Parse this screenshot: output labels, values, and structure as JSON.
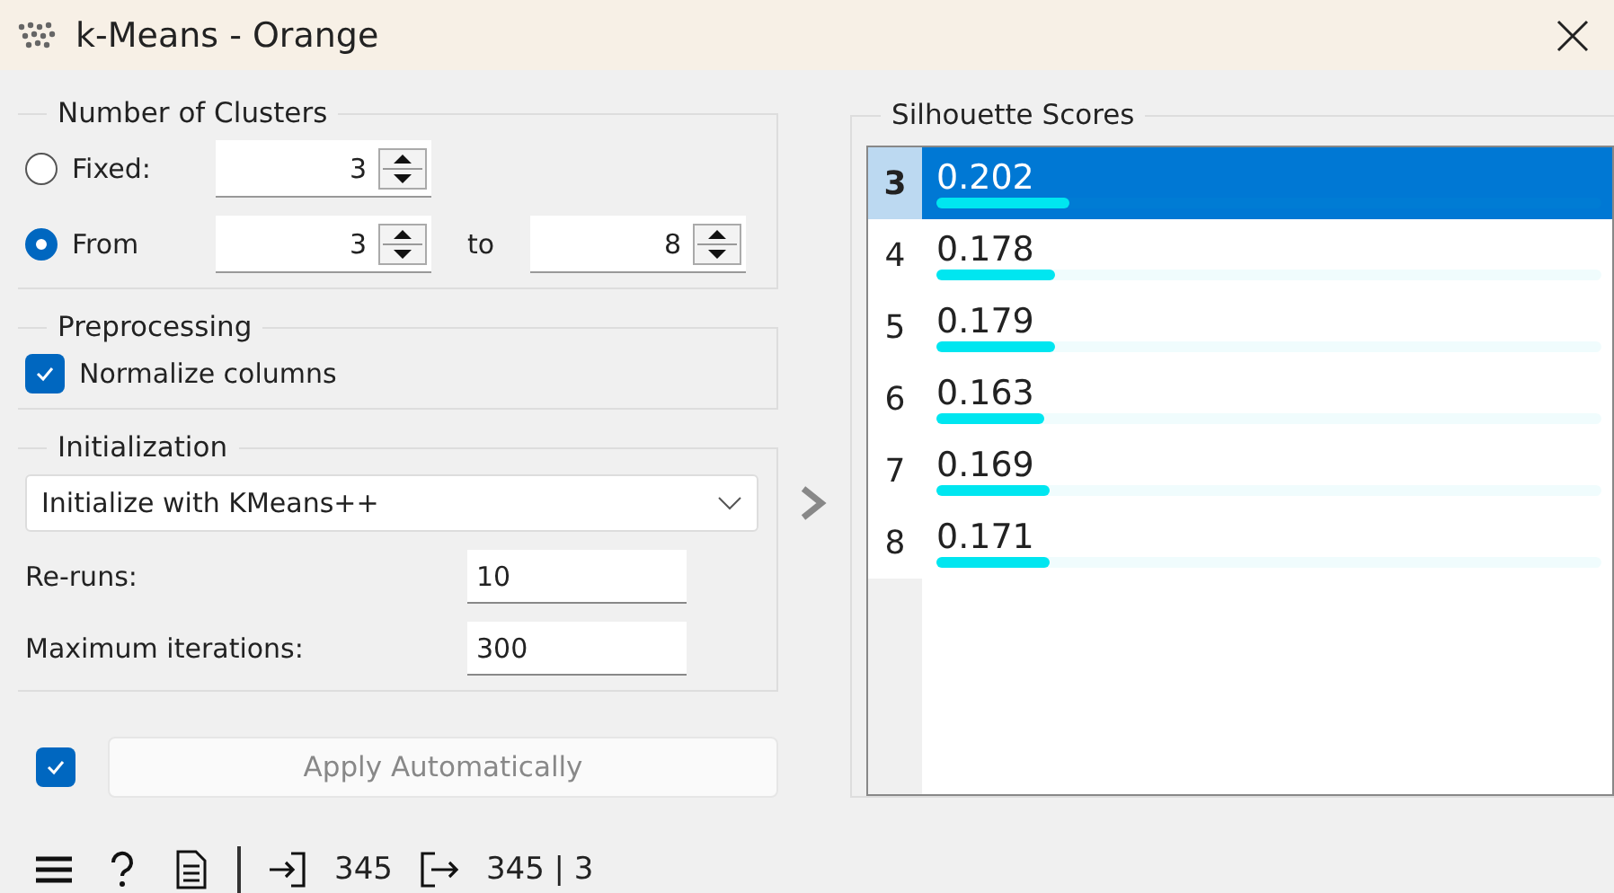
{
  "window": {
    "title": "k-Means - Orange"
  },
  "clusters": {
    "title": "Number of Clusters",
    "options": [
      {
        "label": "Fixed:",
        "selected": false,
        "values": [
          "3"
        ]
      },
      {
        "label": "From",
        "selected": true,
        "values": [
          "3",
          "8"
        ],
        "joiner": "to"
      }
    ]
  },
  "preprocessing": {
    "title": "Preprocessing",
    "checkbox": {
      "label": "Normalize columns",
      "checked": true
    }
  },
  "initialization": {
    "title": "Initialization",
    "method": "Initialize with KMeans++",
    "fields": [
      {
        "label": "Re-runs:",
        "value": "10"
      },
      {
        "label": "Maximum iterations:",
        "value": "300"
      }
    ]
  },
  "apply": {
    "checked": true,
    "label": "Apply Automatically"
  },
  "status_bar": {
    "input_count": "345",
    "output_count": "345 | 3"
  },
  "silhouette": {
    "title": "Silhouette Scores",
    "rows": [
      {
        "k": "3",
        "score": "0.202",
        "level": 0.2,
        "selected": true
      },
      {
        "k": "4",
        "score": "0.178",
        "level": 0.178,
        "selected": false
      },
      {
        "k": "5",
        "score": "0.179",
        "level": 0.179,
        "selected": false
      },
      {
        "k": "6",
        "score": "0.163",
        "level": 0.163,
        "selected": false
      },
      {
        "k": "7",
        "score": "0.169",
        "level": 0.169,
        "selected": false
      },
      {
        "k": "8",
        "score": "0.171",
        "level": 0.171,
        "selected": false
      }
    ]
  }
}
